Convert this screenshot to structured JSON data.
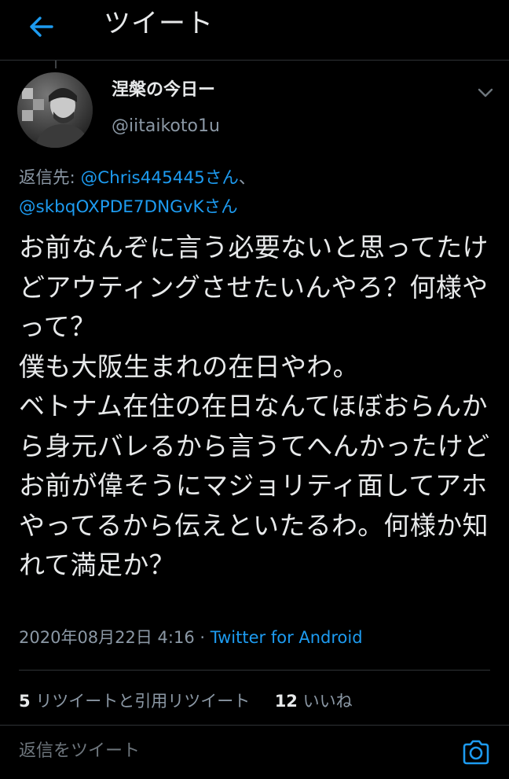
{
  "header": {
    "title": "ツイート",
    "back_icon": "arrow-left-icon"
  },
  "tweet": {
    "display_name": "涅槃の今日ー",
    "handle": "@iitaikoto1u",
    "replying_prefix": "返信先: ",
    "mention_1": "@Chris445445さん",
    "mention_sep": "、",
    "mention_2": "@skbqOXPDE7DNGvKさん",
    "text": "お前なんぞに言う必要ないと思ってたけどアウティングさせたいんやろ？何様やって？\n僕も大阪生まれの在日やわ。\nベトナム在住の在日なんてほぼおらんから身元バレるから言うてへんかったけどお前が偉そうにマジョリティ面してアホやってるから伝えといたるわ。何様か知れて満足か？",
    "timestamp": "2020年08月22日 4:16",
    "meta_sep": " · ",
    "source": "Twitter for Android"
  },
  "stats": {
    "retweets_count": "5",
    "retweets_label": "リツイートと引用リツイート",
    "likes_count": "12",
    "likes_label": "いいね"
  },
  "composer": {
    "placeholder": "返信をツイート",
    "camera_icon": "camera-icon"
  },
  "colors": {
    "background": "#000000",
    "accent": "#1d9bf0",
    "text_primary": "#e7e9ea",
    "text_secondary": "#8b98a5",
    "divider": "#2f3336"
  }
}
